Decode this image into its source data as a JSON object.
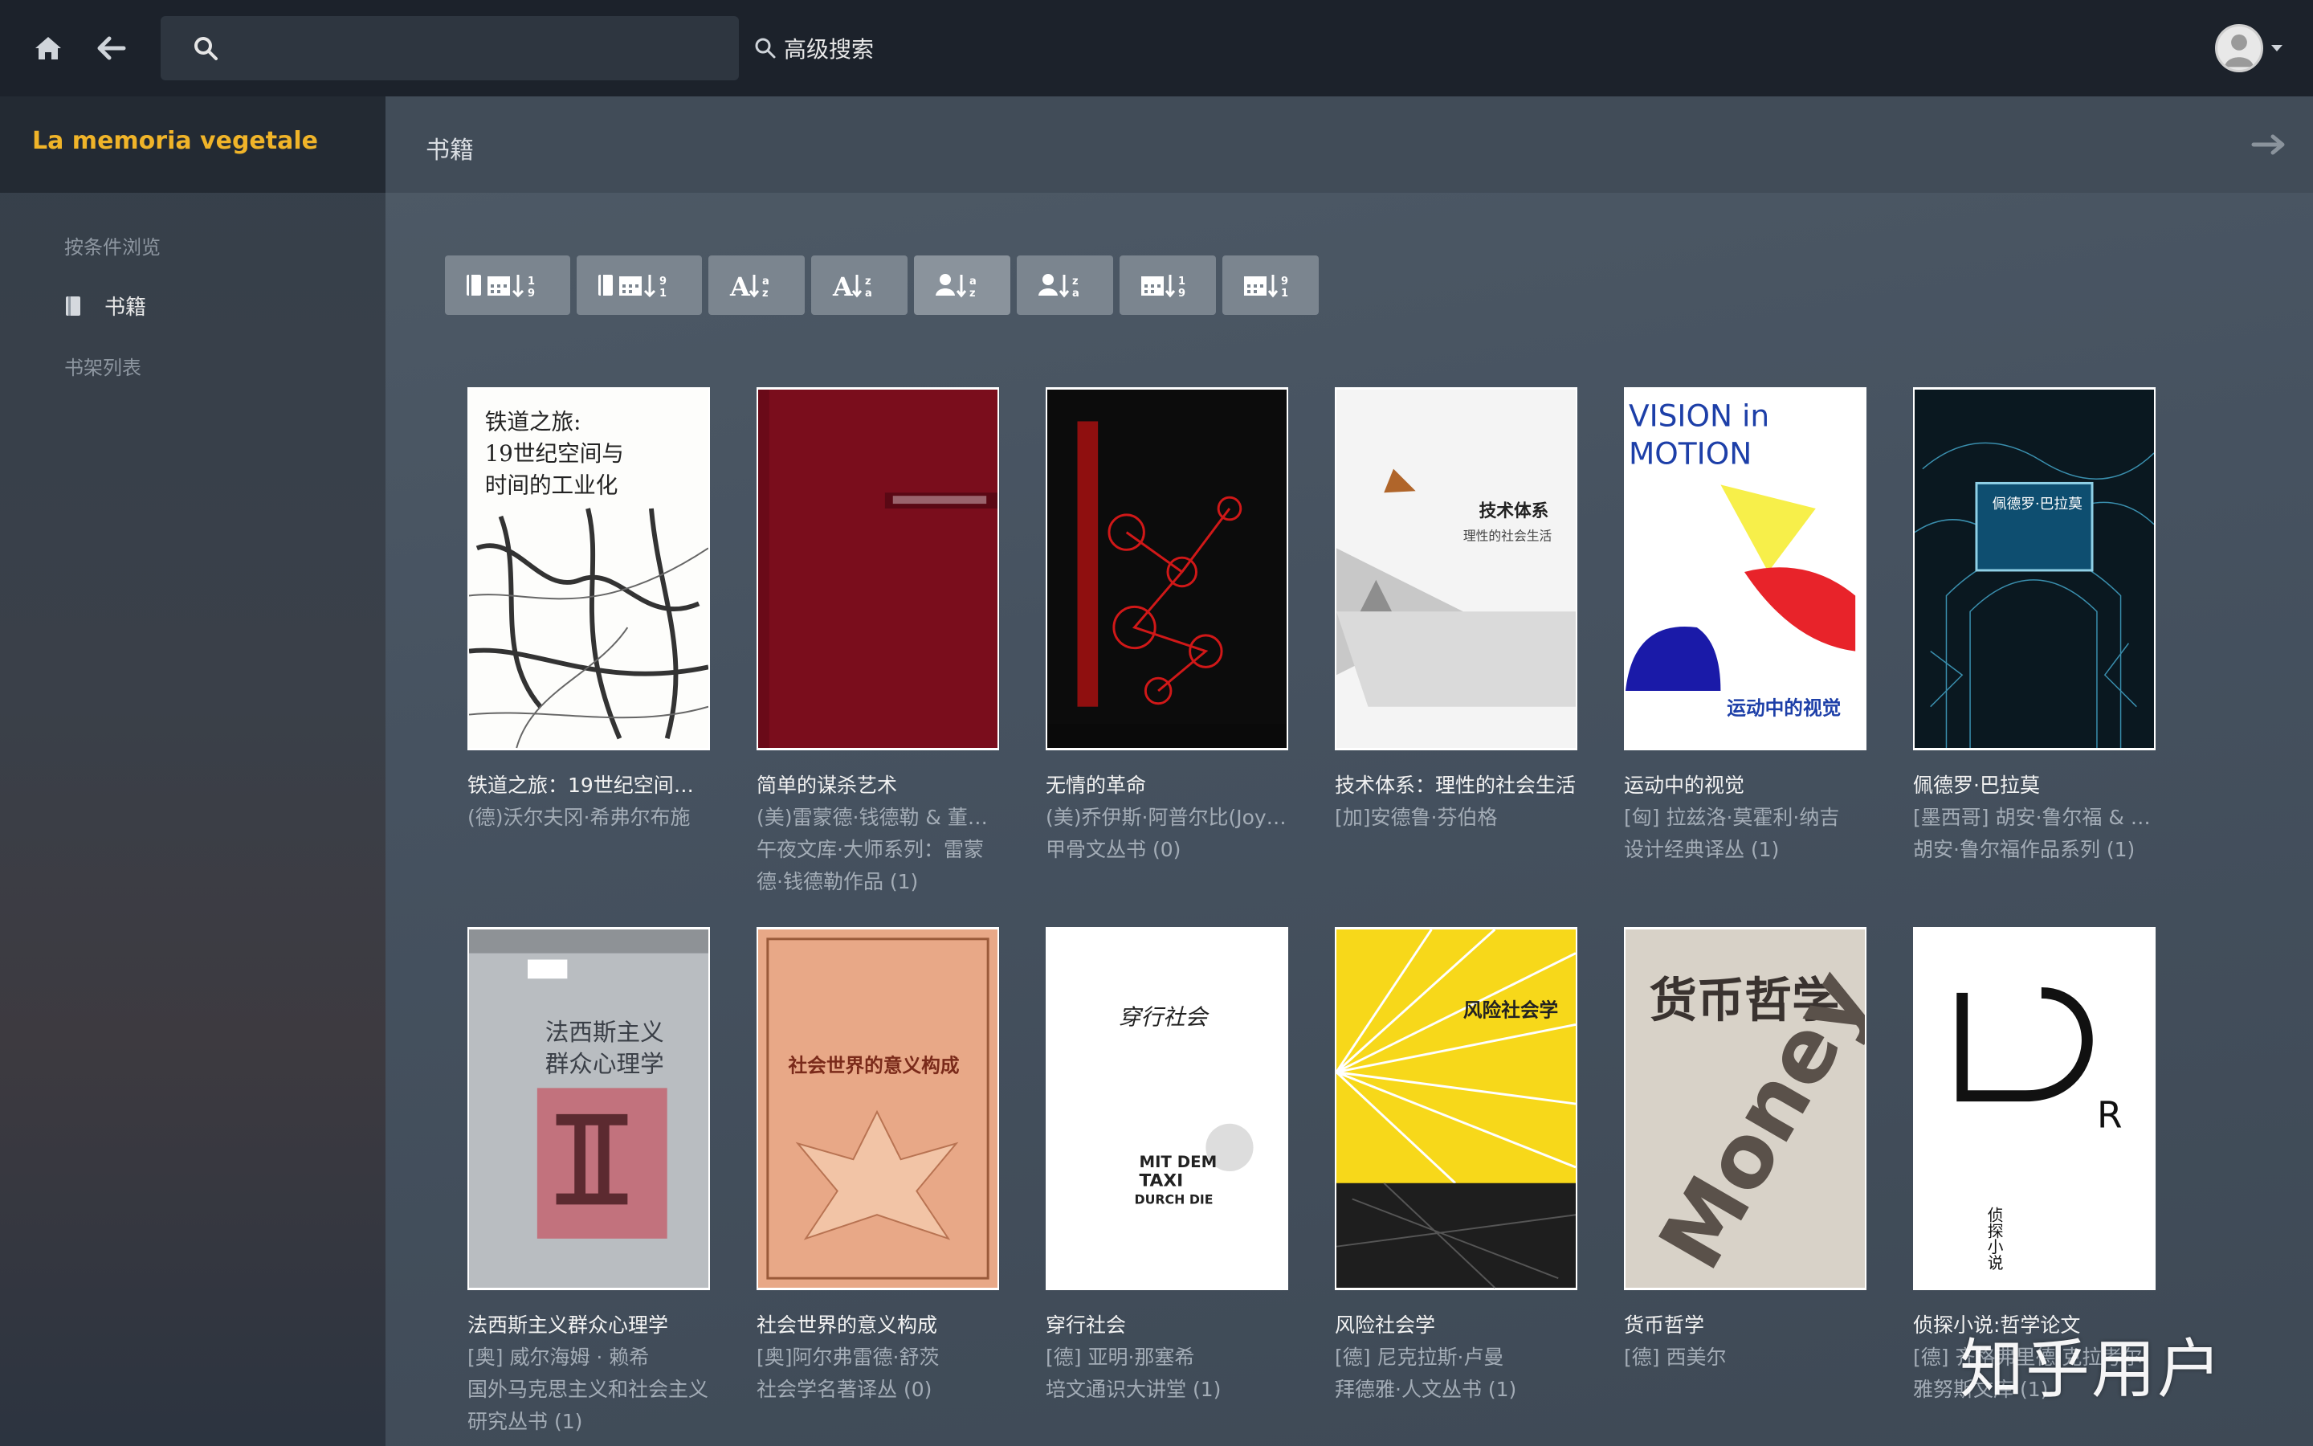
{
  "topbar": {
    "search_placeholder": "",
    "advanced_search_label": "高级搜索"
  },
  "sidebar": {
    "library_name": "La memoria vegetale",
    "items": [
      {
        "label": "按条件浏览"
      },
      {
        "label": "书籍"
      },
      {
        "label": "书架列表"
      }
    ]
  },
  "main": {
    "page_title": "书籍",
    "sort_buttons": [
      {
        "label": "sort-by-date-added-asc"
      },
      {
        "label": "sort-by-date-added-desc"
      },
      {
        "label": "Az"
      },
      {
        "label": "Za"
      },
      {
        "label": "sort-by-author-az"
      },
      {
        "label": "sort-by-author-za"
      },
      {
        "label": "sort-by-pubdate-asc"
      },
      {
        "label": "sort-by-pubdate-desc"
      }
    ],
    "books": [
      {
        "title": "铁道之旅：19世纪空间与时间的工业化",
        "author": "(德)沃尔夫冈·希弗尔布施",
        "series": "",
        "cover_color": "#ffffff"
      },
      {
        "title": "简单的谋杀艺术",
        "author": "(美)雷蒙德·钱德勒 & 董秋芳",
        "series": "午夜文库·大师系列：雷蒙德·钱德勒作品 (1)",
        "cover_color": "#7a0d1c"
      },
      {
        "title": "无情的革命",
        "author": "(美)乔伊斯·阿普尔比(Joyce Appleby)",
        "series": "甲骨文丛书 (0)",
        "cover_color": "#0c0c0c"
      },
      {
        "title": "技术体系：理性的社会生活",
        "author": "[加]安德鲁·芬伯格",
        "series": "",
        "cover_color": "#f4f4f4"
      },
      {
        "title": "运动中的视觉",
        "author": "[匈] 拉兹洛·莫霍利·纳吉",
        "series": "设计经典译丛 (1)",
        "cover_color": "#ffffff"
      },
      {
        "title": "佩德罗·巴拉莫",
        "author": "[墨西哥] 胡安·鲁尔福 & 屠孟超",
        "series": "胡安·鲁尔福作品系列 (1)",
        "cover_color": "#0a1820"
      },
      {
        "title": "法西斯主义群众心理学",
        "author": "[奥] 威尔海姆 · 赖希",
        "series": "国外马克思主义和社会主义研究丛书 (1)",
        "cover_color": "#b8bcc0"
      },
      {
        "title": "社会世界的意义构成",
        "author": "[奥]阿尔弗雷德·舒茨",
        "series": "社会学名著译丛 (0)",
        "cover_color": "#e8a887"
      },
      {
        "title": "穿行社会",
        "author": "[德] 亚明·那塞希",
        "series": "培文通识大讲堂 (1)",
        "cover_color": "#ffffff"
      },
      {
        "title": "风险社会学",
        "author": "[德] 尼克拉斯·卢曼",
        "series": "拜德雅·人文丛书 (1)",
        "cover_color": "#f7d81a"
      },
      {
        "title": "货币哲学",
        "author": "[德] 西美尔",
        "series": "",
        "cover_color": "#d8d2c8"
      },
      {
        "title": "侦探小说:哲学论文",
        "author": "[德] 齐格弗里德·克拉考尔",
        "series": "雅努斯文库 (1)",
        "cover_color": "#ffffff"
      }
    ]
  },
  "watermark": "知乎用户"
}
